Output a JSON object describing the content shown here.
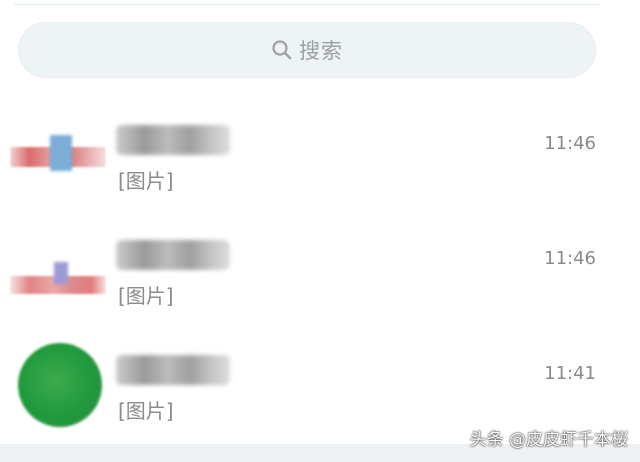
{
  "search": {
    "placeholder": "搜索"
  },
  "chats": [
    {
      "preview": "[图片]",
      "time": "11:46"
    },
    {
      "preview": "[图片]",
      "time": "11:46"
    },
    {
      "preview": "[图片]",
      "time": "11:41"
    }
  ],
  "watermark": "头条 @皮皮虾千本桜",
  "colors": {
    "search_bg": "#eef3f6",
    "secondary_text": "#8b8b8b"
  }
}
